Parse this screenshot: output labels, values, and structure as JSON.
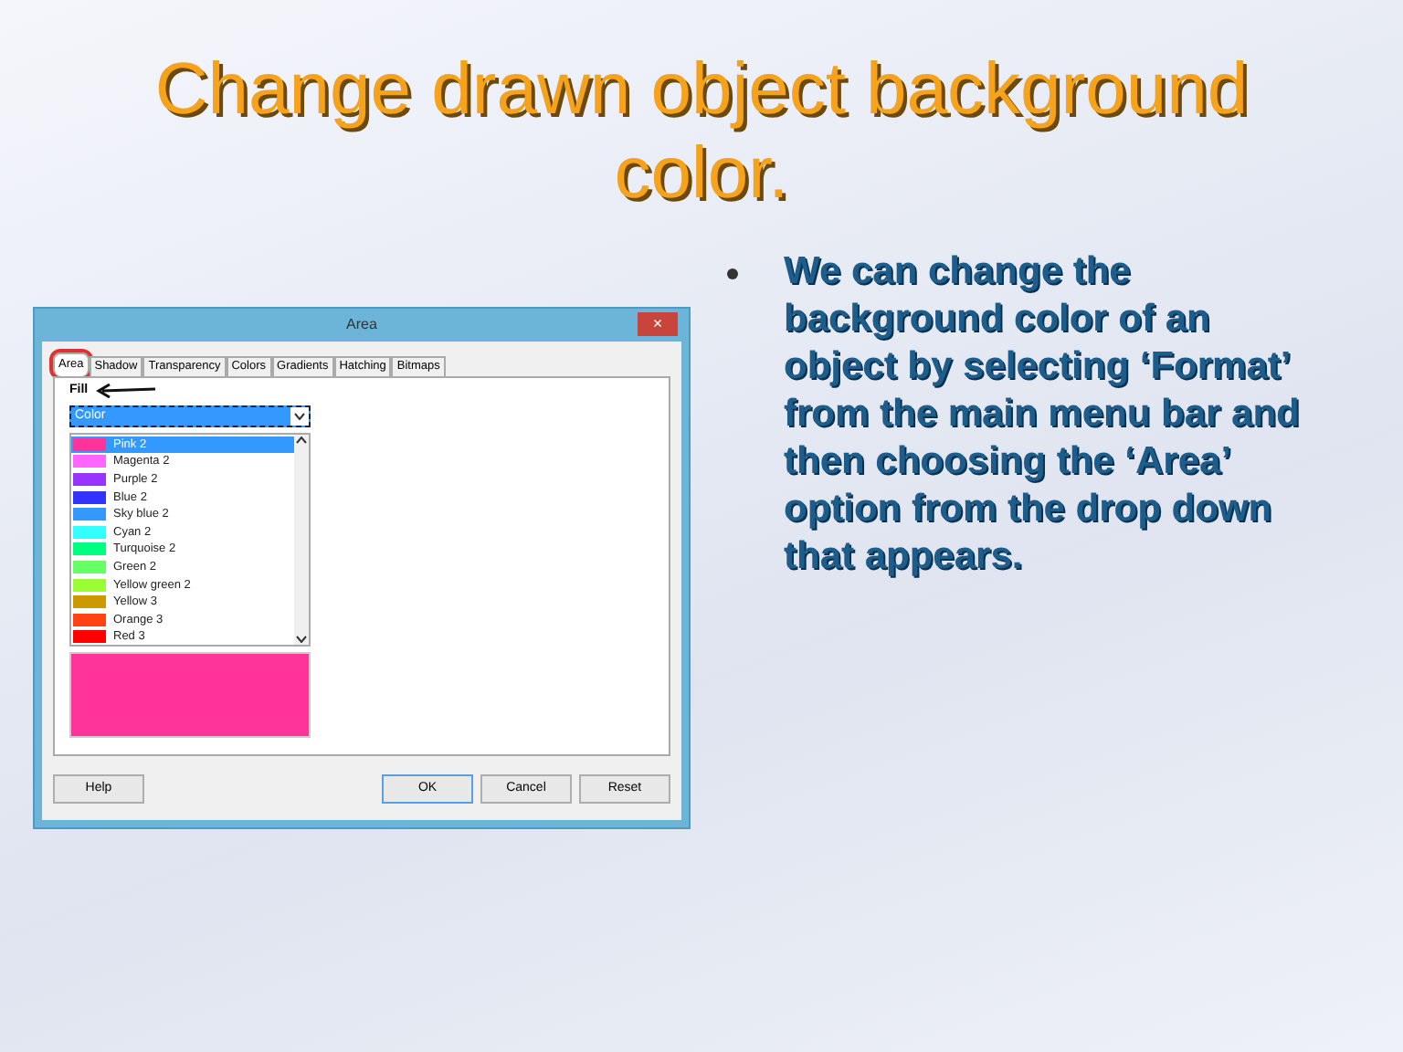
{
  "slide": {
    "title": "Change drawn object background color.",
    "bullets": [
      "We can change the background color of an object by selecting ‘Format’ from the main menu bar and then choosing the ‘Area’ option from the drop down that appears."
    ]
  },
  "dialog": {
    "title": "Area",
    "close": "×",
    "tabs": [
      {
        "label": "Area",
        "selected": true,
        "circled": true
      },
      {
        "label": "Shadow",
        "selected": false,
        "circled": false
      },
      {
        "label": "Transparency",
        "selected": false,
        "circled": false
      },
      {
        "label": "Colors",
        "selected": false,
        "circled": false
      },
      {
        "label": "Gradients",
        "selected": false,
        "circled": false
      },
      {
        "label": "Hatching",
        "selected": false,
        "circled": false
      },
      {
        "label": "Bitmaps",
        "selected": false,
        "circled": false
      }
    ],
    "fill_label": "Fill",
    "fill_type": {
      "value": "Color"
    },
    "colors": [
      {
        "name": "Pink 2",
        "color": "#ff3399",
        "selected": true
      },
      {
        "name": "Magenta 2",
        "color": "#ff66ff",
        "selected": false
      },
      {
        "name": "Purple 2",
        "color": "#9933ff",
        "selected": false
      },
      {
        "name": "Blue 2",
        "color": "#3333ff",
        "selected": false
      },
      {
        "name": "Sky blue 2",
        "color": "#3399ff",
        "selected": false
      },
      {
        "name": "Cyan 2",
        "color": "#33ffff",
        "selected": false
      },
      {
        "name": "Turquoise 2",
        "color": "#00ff80",
        "selected": false
      },
      {
        "name": "Green 2",
        "color": "#66ff66",
        "selected": false
      },
      {
        "name": "Yellow green 2",
        "color": "#99ff33",
        "selected": false
      },
      {
        "name": "Yellow 3",
        "color": "#cc9900",
        "selected": false
      },
      {
        "name": "Orange 3",
        "color": "#ff4411",
        "selected": false
      },
      {
        "name": "Red 3",
        "color": "#ff0000",
        "selected": false
      }
    ],
    "preview": {
      "color": "#ff3399"
    },
    "buttons": [
      {
        "label": "Help",
        "kind": "left",
        "default": false
      },
      {
        "label": "OK",
        "kind": "right",
        "default": true
      },
      {
        "label": "Cancel",
        "kind": "right",
        "default": false
      },
      {
        "label": "Reset",
        "kind": "right",
        "default": false
      }
    ]
  }
}
